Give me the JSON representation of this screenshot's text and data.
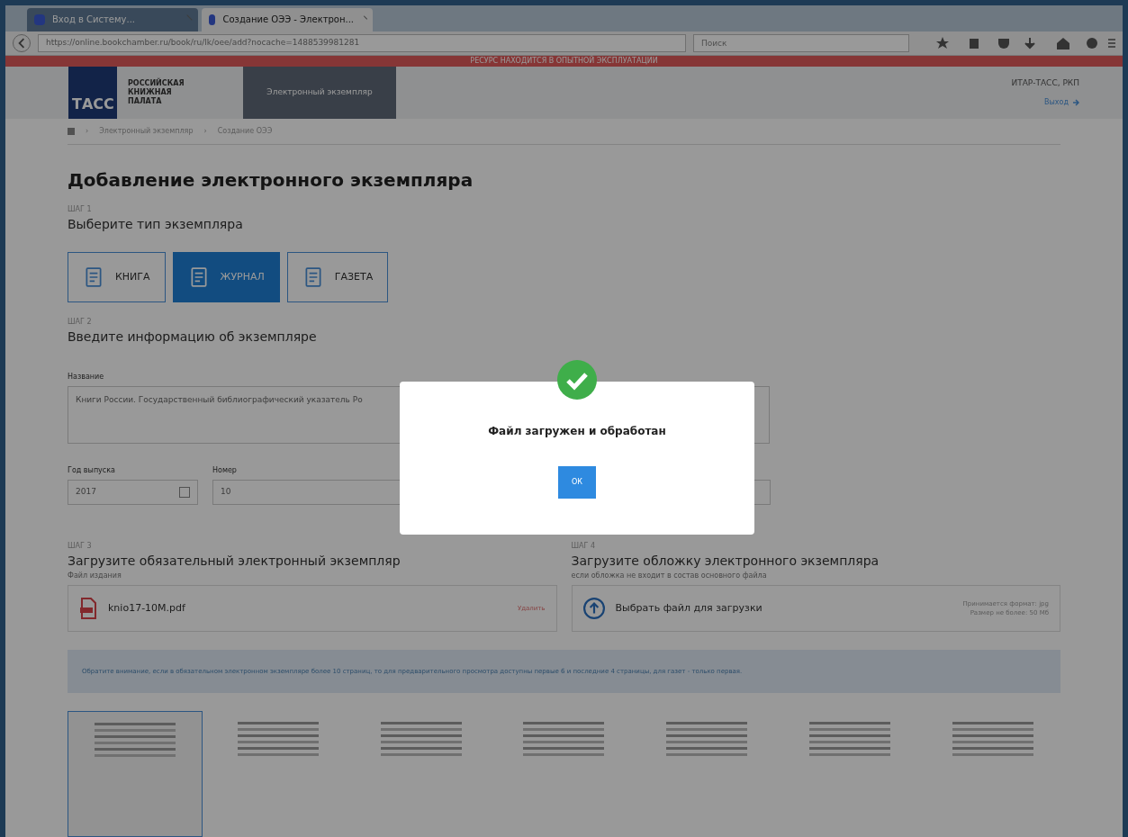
{
  "browser": {
    "tabs": [
      {
        "title": "Вход в Систему...",
        "selected": false
      },
      {
        "title": "Создание ОЭЭ - Электрон...",
        "selected": true
      }
    ],
    "url": "https://online.bookchamber.ru/book/ru/lk/oee/add?nocache=1488539981281",
    "search": {
      "placeholder": "Поиск"
    }
  },
  "banner": "РЕСУРС НАХОДИТСЯ В ОПЫТНОЙ ЭКСПЛУАТАЦИИ",
  "header": {
    "logo": "ТАСС",
    "org": [
      "РОССИЙСКАЯ",
      "КНИЖНАЯ",
      "ПАЛАТА"
    ],
    "section": "Электронный экземпляр",
    "user": "ИТАР-ТАСС, РКП",
    "logout": "Выход"
  },
  "breadcrumbs": [
    {
      "sep": "›",
      "label": "Электронный экземпляр"
    },
    {
      "sep": "›",
      "label": "Создание ОЭЭ"
    }
  ],
  "title": "Добавление электронного экземпляра",
  "step1": {
    "step": "ШАГ 1",
    "title": "Выберите тип экземпляра",
    "types": [
      {
        "label": "КНИГА",
        "selected": false
      },
      {
        "label": "ЖУРНАЛ",
        "selected": true
      },
      {
        "label": "ГАЗЕТА",
        "selected": false
      }
    ]
  },
  "step2": {
    "step": "ШАГ 2",
    "title": "Введите информацию об экземпляре",
    "name_label": "Название",
    "name_value": "Книги России. Государственный библиографический указатель Ро",
    "year_label": "Год выпуска",
    "year_value": "2017",
    "number_label": "Номер",
    "number_value": "10"
  },
  "step3": {
    "step": "ШАГ 3",
    "title": "Загрузите обязательный электронный экземпляр",
    "hint": "Файл издания",
    "file": "knio17-10M.pdf",
    "remove": "Удалить"
  },
  "step4": {
    "step": "ШАГ 4",
    "title": "Загрузите обложку электронного экземпляра",
    "hint": "если обложка не входит в состав основного файла",
    "choose": "Выбрать файл для загрузки",
    "format": "Принимается формат: jpg",
    "size": "Размер не более: 50 Мб"
  },
  "notice": "Обратите внимание, если в обязательном электронном экземпляре более 10 страниц, то для предварительного просмотра доступны первые 6 и последние 4 страницы, для газет - только первая.",
  "pages": [
    {
      "selected": true
    },
    {
      "selected": false
    },
    {
      "selected": false
    },
    {
      "selected": false
    },
    {
      "selected": false
    },
    {
      "selected": false
    },
    {
      "selected": false
    }
  ],
  "dialog": {
    "message": "Файл загружен и обработан",
    "button": "ОК"
  }
}
